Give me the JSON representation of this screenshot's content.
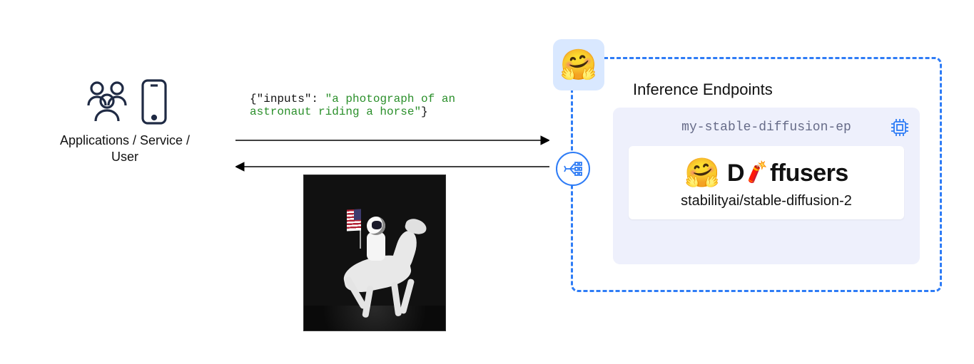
{
  "left": {
    "label": "Applications / Service /\nUser"
  },
  "request": {
    "key": "\"inputs\"",
    "value": "\"a photograph of an\nastronaut riding a horse\""
  },
  "response": {
    "image_description": "astronaut riding a white horse holding an American flag on dark ground"
  },
  "endpoint": {
    "title": "Inference Endpoints",
    "name": "my-stable-diffusion-ep",
    "library_prefix": "D",
    "library_suffix": "ffusers",
    "model_id": "stabilityai/stable-diffusion-2"
  },
  "icons": {
    "hf": "🤗",
    "dynamite": "🧨"
  }
}
